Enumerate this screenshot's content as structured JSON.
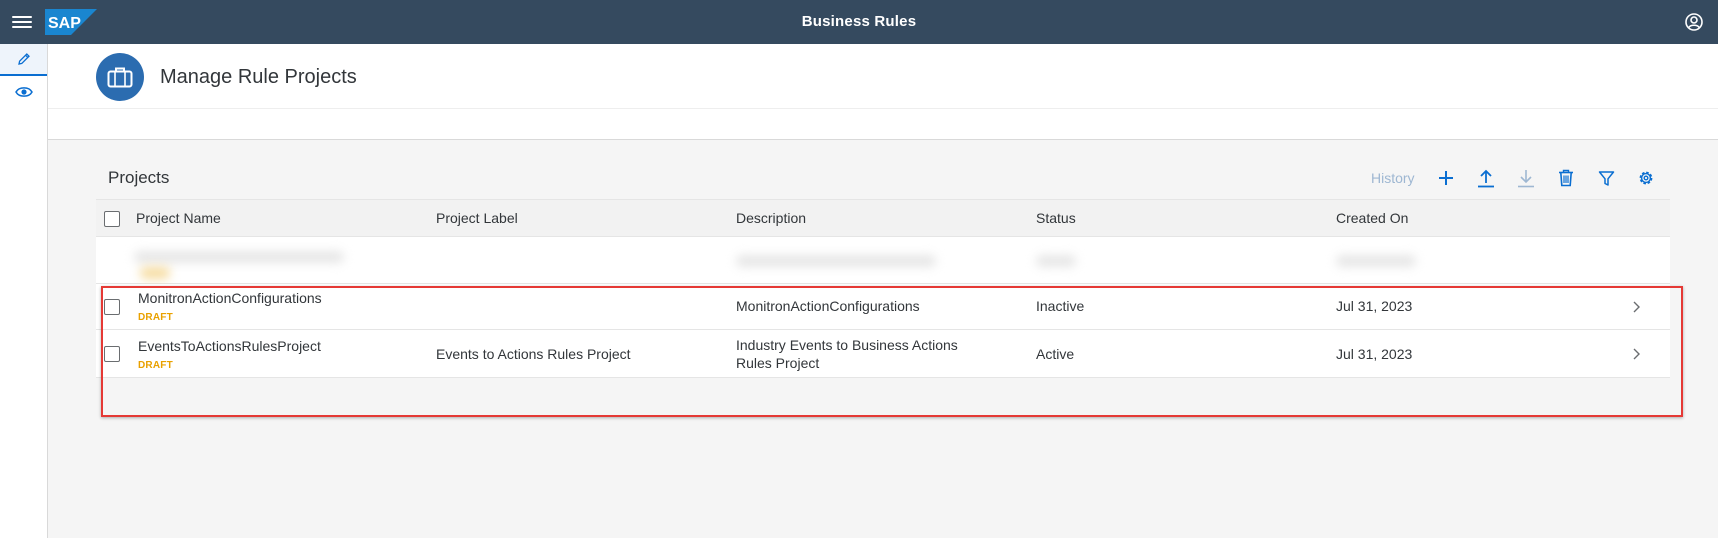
{
  "shell": {
    "title": "Business Rules",
    "logo_text": "SAP"
  },
  "sidenav": {
    "items": [
      {
        "icon": "pencil-icon",
        "selected": true
      },
      {
        "icon": "eye-icon",
        "selected": false
      }
    ]
  },
  "header": {
    "title": "Manage Rule Projects",
    "icon": "briefcase-icon"
  },
  "toolbar": {
    "title": "Projects",
    "history_label": "History"
  },
  "table": {
    "columns": [
      "Project Name",
      "Project Label",
      "Description",
      "Status",
      "Created On"
    ],
    "rows": [
      {
        "name": "MonitronActionConfigurations",
        "state": "DRAFT",
        "label": "",
        "description": "MonitronActionConfigurations",
        "status": "Inactive",
        "created_on": "Jul 31, 2023"
      },
      {
        "name": "EventsToActionsRulesProject",
        "state": "DRAFT",
        "label": "Events to Actions Rules Project",
        "description": "Industry Events to Business Actions Rules Project",
        "status": "Active",
        "created_on": "Jul 31, 2023"
      }
    ]
  },
  "colors": {
    "shell": "#354a5f",
    "accent": "#0a6ed1",
    "draft": "#e9a100",
    "highlight": "#e53935"
  }
}
